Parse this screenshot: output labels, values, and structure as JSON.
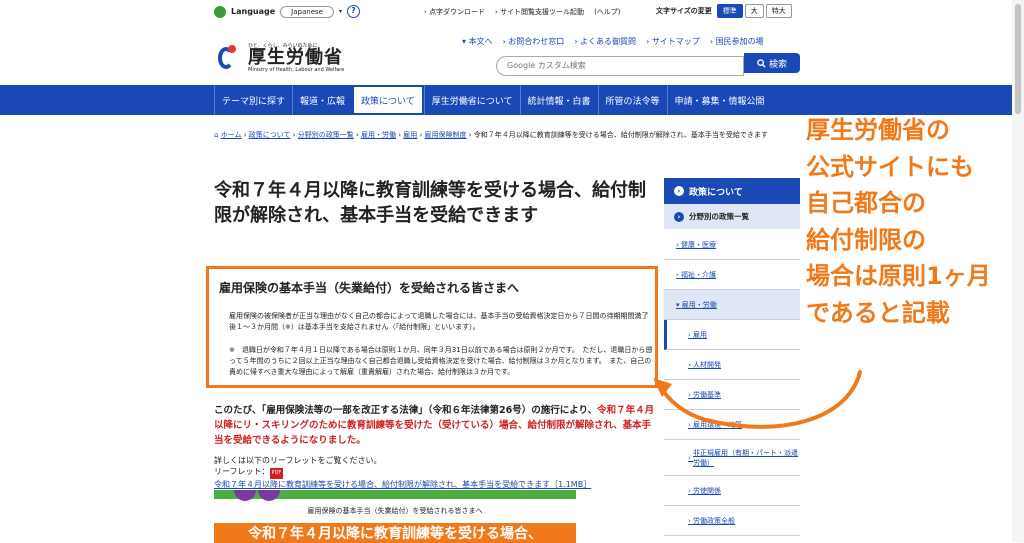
{
  "util": {
    "language_label": "Language",
    "language_value": "Japanese",
    "links": [
      "点字ダウンロード",
      "サイト閲覧支援ツール起動",
      "(ヘルプ)"
    ],
    "fontsize_label": "文字サイズの変更",
    "fontsize_options": [
      "標準",
      "大",
      "特大"
    ]
  },
  "logo": {
    "tagline": "ひと、くらし、みらいのために",
    "name": "厚生労働省",
    "en": "Ministry of Health, Labour and Welfare"
  },
  "toplinks": [
    "本文へ",
    "お問合わせ窓口",
    "よくある御質問",
    "サイトマップ",
    "国民参加の場"
  ],
  "search": {
    "placeholder": "Google カスタム検索",
    "button": "検索"
  },
  "nav": [
    "テーマ別に探す",
    "報道・広報",
    "政策について",
    "厚生労働省について",
    "統計情報・白書",
    "所管の法令等",
    "申請・募集・情報公開"
  ],
  "breadcrumb": {
    "items": [
      "ホーム",
      "政策について",
      "分野別の政策一覧",
      "雇用・労働",
      "雇用",
      "雇用保険制度"
    ],
    "current": "令和７年４月以降に教育訓練等を受ける場合、給付制限が解除され、基本手当を受給できます"
  },
  "page_title": "令和７年４月以降に教育訓練等を受ける場合、給付制限が解除され、基本手当を受給できます",
  "notice": {
    "heading": "雇用保険の基本手当（失業給付）を受給される皆さまへ",
    "paragraph": "雇用保険の被保険者が正当な理由がなく自己の都合によって退職した場合には、基本手当の受給資格決定日から７日間の待期期間満了後１～３か月間（※）は基本手当を支給されません（「給付制限」といいます）。",
    "note": "※　退職日が令和７年４月１日以降である場合は原則１か月、同年３月31日以前である場合は原則２か月です。　ただし、退職日から遡って５年間のうちに２回以上正当な理由なく自己都合退職し受給資格決定を受けた場合、給付制限は３か月となります。　また、自己の責めに帰すべき重大な理由によって解雇（重責解雇）された場合、給付制限は３か月です。"
  },
  "intro": {
    "lead": "このたび、「雇用保険法等の一部を改正する法律」（令和６年法律第26号）の施行により、",
    "red": "令和７年４月以降にリ・スキリングのために教育訓練等を受けた（受けている）場合、給付制限が解除され、基本手当を受給できるようになりました。"
  },
  "details": {
    "line1": "詳しくは以下のリーフレットをご覧ください。",
    "leaflet_label": "リーフレット：",
    "pdf_badge": "PDF",
    "leaflet_link": "令和７年４月以降に教育訓練等を受ける場合、給付制限が解除され、基本手当を受給できます［1.1MB］"
  },
  "banner": {
    "sub": "雇用保険の基本手当（失業給付）を受給される皆さまへ",
    "big": "令和７年４月以降に教育訓練等を受ける場合、"
  },
  "sidebar": {
    "head": "政策について",
    "sub": "分野別の政策一覧",
    "items": [
      "健康・医療",
      "福祉・介護",
      "雇用・労働"
    ],
    "subitems": [
      "雇用",
      "人材開発",
      "労働基準",
      "雇用環境・均等",
      "非正規雇用（有期・パート・派遣労働）",
      "労使関係",
      "労働政策全般"
    ]
  },
  "annotation": [
    "厚生労働省の",
    "公式サイトにも",
    "自己都合の",
    "給付制限の",
    "場合は原則1ヶ月",
    "であると記載"
  ],
  "colors": {
    "primary": "#1a49b5",
    "accent": "#f07a1a",
    "red": "#d02020"
  }
}
